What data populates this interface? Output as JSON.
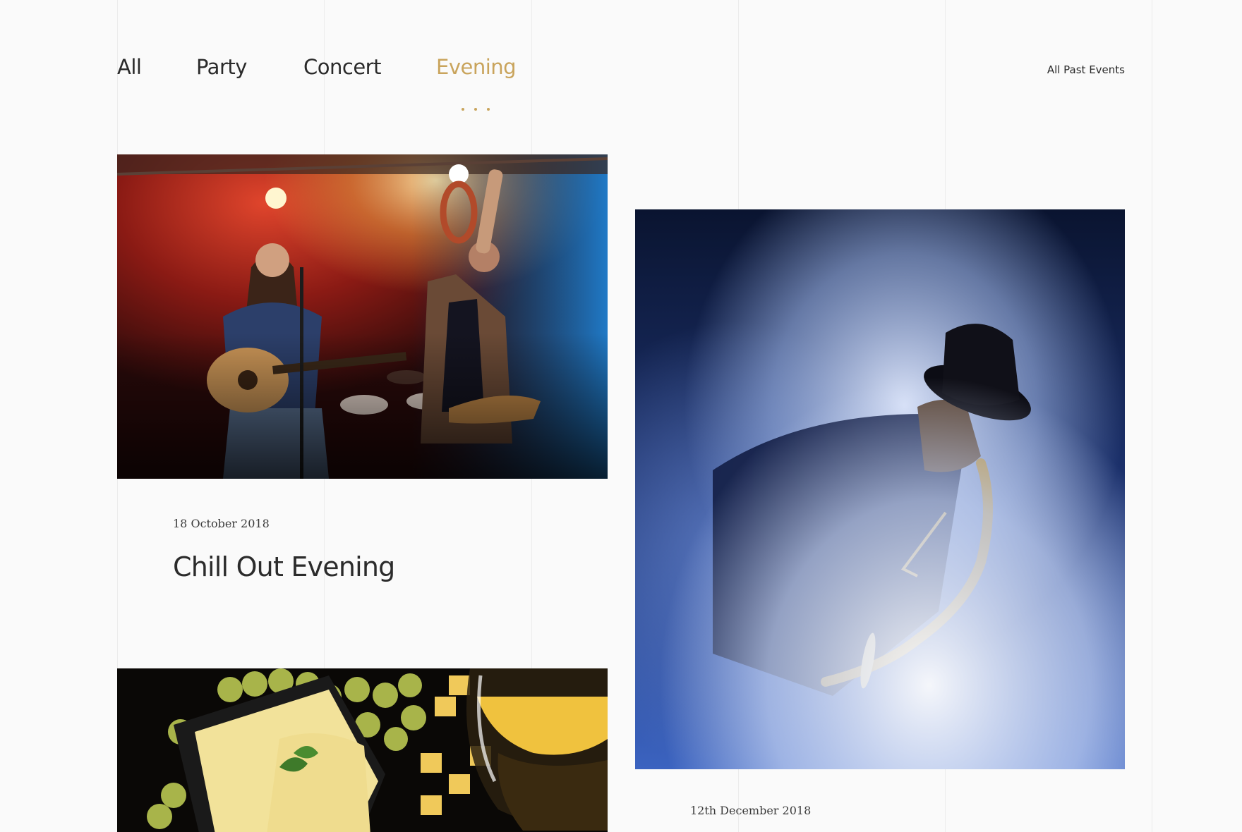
{
  "filters": {
    "items": [
      {
        "label": "All"
      },
      {
        "label": "Party"
      },
      {
        "label": "Concert"
      },
      {
        "label": "Evening"
      }
    ],
    "active": "Evening",
    "accent_color": "#c9a45c"
  },
  "past_events_link": "All Past Events",
  "events": [
    {
      "date": "18 October 2018",
      "title": "Chill Out Evening",
      "image": "live-acoustic-band-photo"
    },
    {
      "date": "12th December 2018",
      "image": "saxophonist-in-smoke-photo"
    },
    {
      "image": "cheese-grapes-wine-photo"
    }
  ]
}
